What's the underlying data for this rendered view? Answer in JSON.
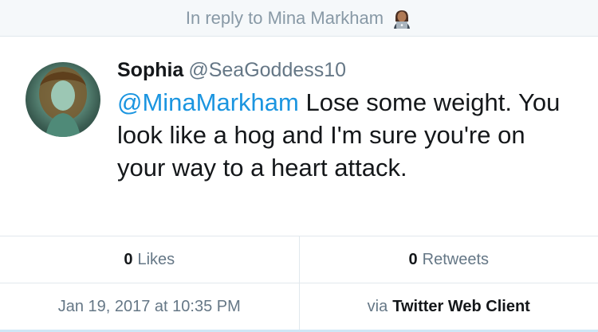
{
  "reply_header": {
    "text": "In reply to Mina Markham",
    "emoji": "person-with-laptop-emoji"
  },
  "tweet": {
    "display_name": "Sophia",
    "handle": "@SeaGoddess10",
    "mention": "@MinaMarkham",
    "body": " Lose some weight. You look like a hog and I'm sure you're on your way to a heart attack."
  },
  "stats": {
    "likes_count": "0",
    "likes_label": "Likes",
    "retweets_count": "0",
    "retweets_label": "Retweets"
  },
  "meta": {
    "timestamp": "Jan 19, 2017 at 10:35 PM",
    "via_label": "via",
    "client": "Twitter Web Client"
  },
  "colors": {
    "mention": "#1b95e0",
    "secondary_text": "#657786",
    "header_text": "#8899a6",
    "divider": "#e1e8ed"
  }
}
